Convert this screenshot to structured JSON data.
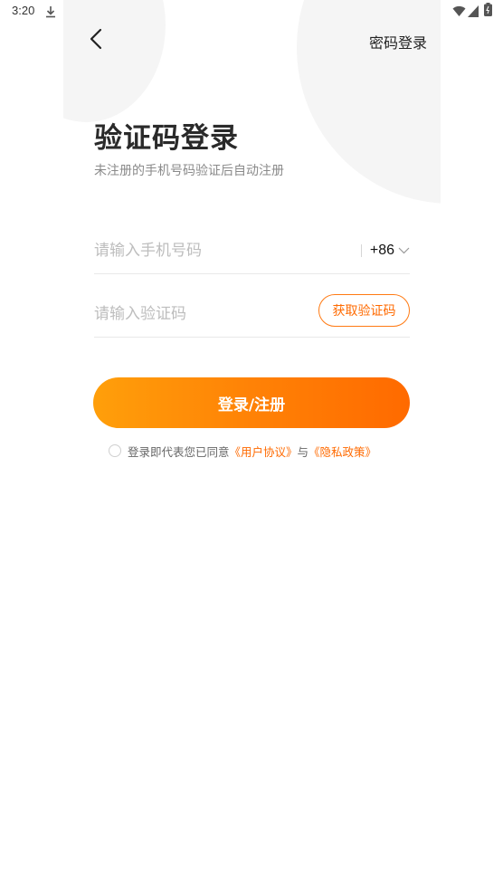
{
  "status_bar": {
    "time": "3:20",
    "icons_left": [
      "download-icon",
      "a-badge-icon"
    ],
    "icons_right": [
      "wifi-icon",
      "signal-icon",
      "battery-icon"
    ]
  },
  "header": {
    "back_icon": "chevron-left-icon",
    "password_login_label": "密码登录"
  },
  "title": "验证码登录",
  "subtitle": "未注册的手机号码验证后自动注册",
  "phone": {
    "placeholder": "请输入手机号码",
    "value": "",
    "country_code": "+86"
  },
  "code": {
    "placeholder": "请输入验证码",
    "value": "",
    "get_code_label": "获取验证码"
  },
  "login_button": "登录/注册",
  "agreement": {
    "checked": false,
    "prefix": "登录即代表您已同意",
    "user_agreement": "《用户协议》",
    "connector": "与",
    "privacy_policy": "《隐私政策》"
  },
  "colors": {
    "accent": "#ff6a00",
    "gradient_start": "#ff9f0a",
    "gradient_end": "#ff6a00",
    "decor_circle": "#f5f5f5"
  }
}
